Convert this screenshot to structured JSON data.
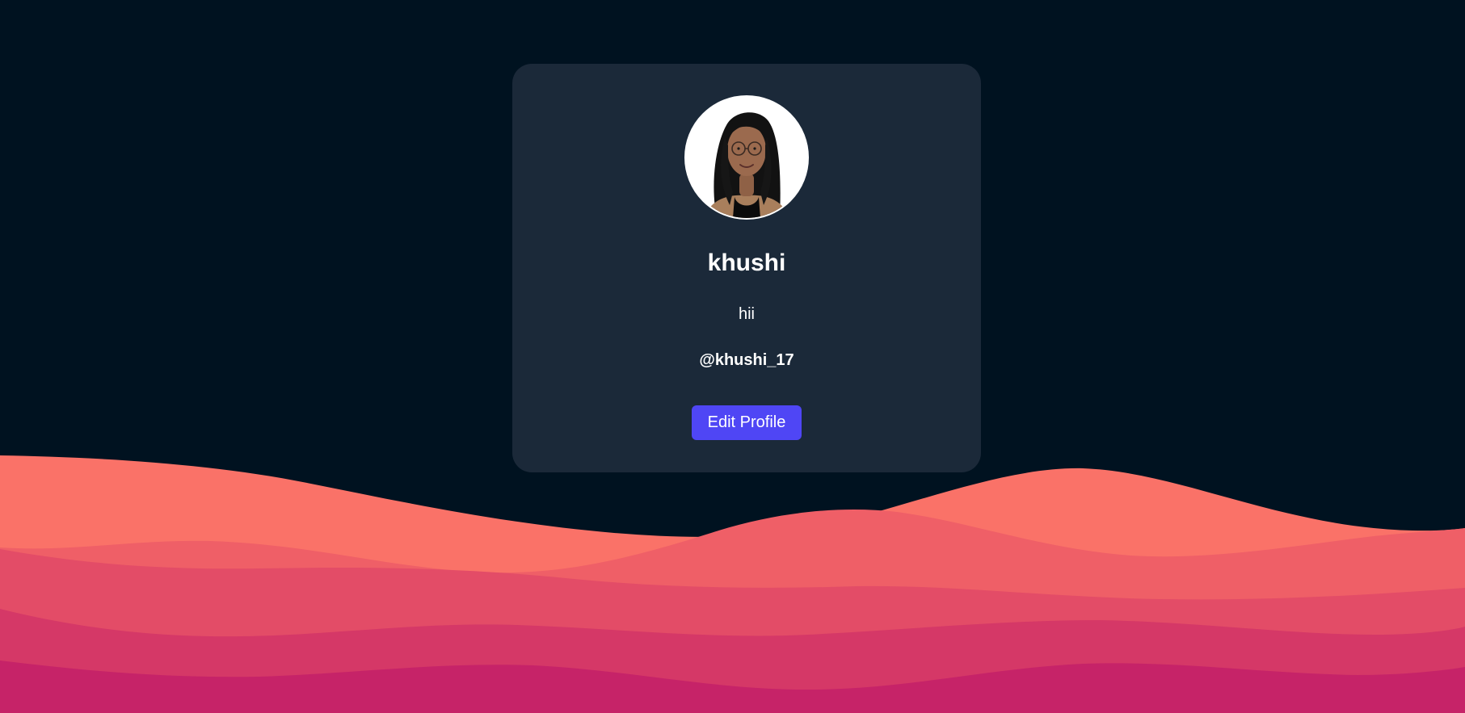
{
  "profile": {
    "name": "khushi",
    "bio": "hii",
    "handle": "@khushi_17",
    "avatar_alt": "profile photo"
  },
  "actions": {
    "edit_label": "Edit Profile"
  },
  "colors": {
    "background": "#001220",
    "card": "#1b2939",
    "button": "#4f46f5",
    "wave_1": "#fa7268",
    "wave_2": "#ef5f67",
    "wave_3": "#e34c67",
    "wave_4": "#d53867",
    "wave_5": "#c62368"
  }
}
